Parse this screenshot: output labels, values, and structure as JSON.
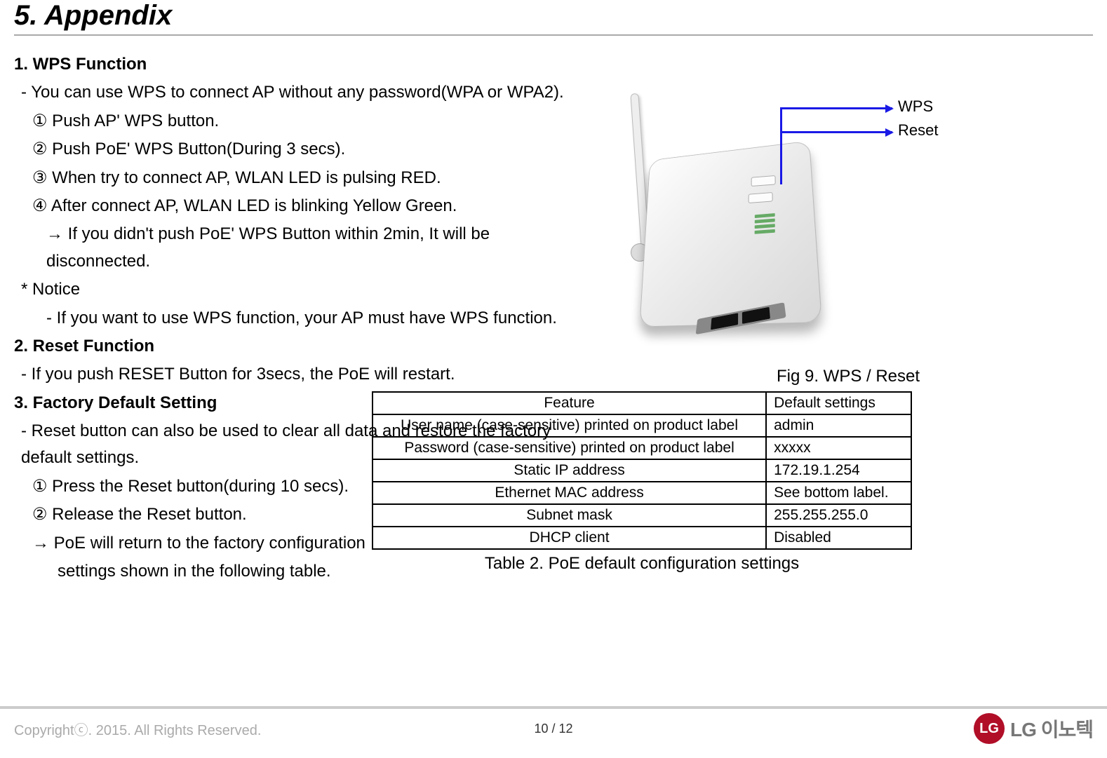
{
  "title": "5. Appendix",
  "sections": {
    "wps": {
      "heading": "1. WPS Function",
      "intro": "- You can use WPS to connect AP without any password(WPA or WPA2).",
      "step1": "① Push AP' WPS button.",
      "step2": "② Push PoE' WPS Button(During 3 secs).",
      "step3": "③ When try to connect AP, WLAN LED is pulsing RED.",
      "step4": "④ After connect AP, WLAN LED is blinking Yellow Green.",
      "note_arrow": "→ If you didn't push PoE' WPS Button within 2min, It will be disconnected.",
      "notice_h": "* Notice",
      "notice_b": "- If you want to use WPS function, your AP must have WPS function."
    },
    "reset": {
      "heading": "2. Reset Function",
      "body": "-  If you push RESET Button for 3secs, the PoE will restart."
    },
    "factory": {
      "heading": "3. Factory Default Setting",
      "intro": "- Reset button can also be used to clear all data and restore the factory default settings.",
      "step1": "① Press the Reset button(during 10 secs).",
      "step2": "② Release the Reset button.",
      "arrow": "→ PoE will return to the factory configuration",
      "arrow2": "settings shown in the following table."
    }
  },
  "figure": {
    "label_wps": "WPS",
    "label_reset": "Reset",
    "caption": "Fig 9. WPS / Reset"
  },
  "table": {
    "headers": {
      "c1": "Feature",
      "c2": "Default settings"
    },
    "rows": [
      {
        "f": "User name (case-sensitive) printed on product label",
        "v": "admin"
      },
      {
        "f": "Password (case-sensitive) printed on product label",
        "v": "xxxxx"
      },
      {
        "f": "Static IP address",
        "v": "172.19.1.254"
      },
      {
        "f": "Ethernet MAC address",
        "v": "See bottom label."
      },
      {
        "f": "Subnet mask",
        "v": "255.255.255.0"
      },
      {
        "f": "DHCP client",
        "v": "Disabled"
      }
    ],
    "caption": "Table 2. PoE default configuration settings"
  },
  "footer": {
    "copyright": "Copyrightⓒ. 2015. All Rights Reserved.",
    "page": "10 / 12",
    "logo_text": "LG 이노텍",
    "logo_mark": "LG"
  }
}
